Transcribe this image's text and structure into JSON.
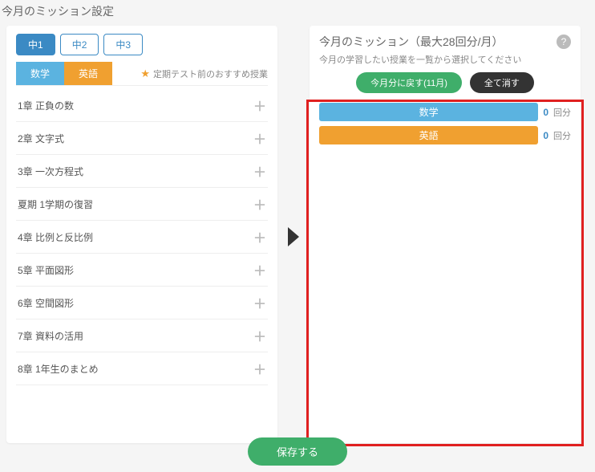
{
  "page_title": "今月のミッション設定",
  "left": {
    "grade_tabs": [
      "中1",
      "中2",
      "中3"
    ],
    "active_grade": 0,
    "subject_tabs": {
      "math": "数学",
      "english": "英語"
    },
    "rec_label": "定期テスト前のおすすめ授業",
    "chapters": [
      "1章 正負の数",
      "2章 文字式",
      "3章 一次方程式",
      "夏期 1学期の復習",
      "4章 比例と反比例",
      "5章 平面図形",
      "6章 空間図形",
      "7章 資料の活用",
      "8章 1年生のまとめ"
    ]
  },
  "right": {
    "title": "今月のミッション（最大28回分/月）",
    "subtitle": "今月の学習したい授業を一覧から選択してください",
    "reset_btn": "今月分に戻す(11月)",
    "clear_btn": "全て消す",
    "subjects": [
      {
        "label": "数学",
        "count": "0",
        "suffix": "回分",
        "cls": "bar-math"
      },
      {
        "label": "英語",
        "count": "0",
        "suffix": "回分",
        "cls": "bar-english"
      }
    ]
  },
  "save_btn": "保存する"
}
